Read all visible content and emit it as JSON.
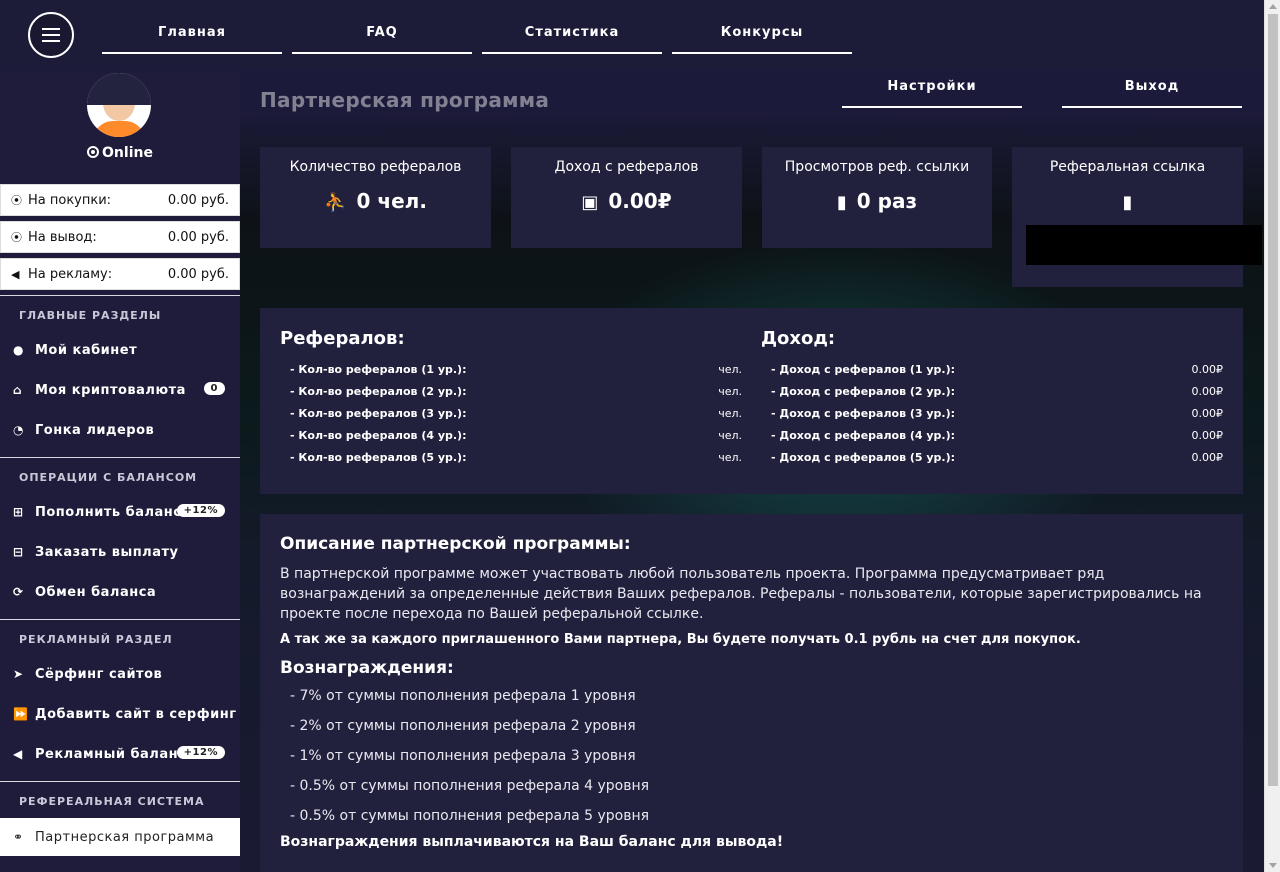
{
  "topnav": [
    "Главная",
    "FAQ",
    "Статистика",
    "Конкурсы"
  ],
  "rightnav": [
    "Настройки",
    "Выход"
  ],
  "user": {
    "status": "Online"
  },
  "balances": [
    {
      "label": "На покупки:",
      "value": "0.00 руб.",
      "icon": "wallet-icon"
    },
    {
      "label": "На вывод:",
      "value": "0.00 руб.",
      "icon": "withdraw-icon"
    },
    {
      "label": "На рекламу:",
      "value": "0.00 руб.",
      "icon": "megaphone-icon"
    }
  ],
  "sections": [
    {
      "title": "ГЛАВНЫЕ РАЗДЕЛЫ",
      "items": [
        {
          "label": "Мой кабинет",
          "icon": "user-icon"
        },
        {
          "label": "Моя криптовалюта",
          "icon": "home-icon",
          "badge": "0"
        },
        {
          "label": "Гонка лидеров",
          "icon": "gauge-icon"
        }
      ]
    },
    {
      "title": "ОПЕРАЦИИ С БАЛАНСОМ",
      "items": [
        {
          "label": "Пополнить баланс",
          "icon": "plus-square-icon",
          "badge": "+12%"
        },
        {
          "label": "Заказать выплату",
          "icon": "minus-square-icon"
        },
        {
          "label": "Обмен баланса",
          "icon": "refresh-icon"
        }
      ]
    },
    {
      "title": "РЕКЛАМНЫЙ РАЗДЕЛ",
      "items": [
        {
          "label": "Сёрфинг сайтов",
          "icon": "pointer-icon"
        },
        {
          "label": "Добавить сайт в серфинг",
          "icon": "fast-forward-icon"
        },
        {
          "label": "Рекламный баланс",
          "icon": "bullhorn-icon",
          "badge": "+12%"
        }
      ]
    },
    {
      "title": "РЕФЕРЕАЛЬНАЯ СИСТЕМА",
      "items": [
        {
          "label": "Партнерская программа",
          "icon": "handshake-icon",
          "active": true
        }
      ]
    }
  ],
  "page": {
    "title": "Партнерская программа"
  },
  "cards": [
    {
      "title": "Количество рефералов",
      "value": "0 чел.",
      "icon": "user-icon"
    },
    {
      "title": "Доход с рефералов",
      "value": "0.00₽",
      "icon": "money-icon"
    },
    {
      "title": "Просмотров реф. ссылки",
      "value": "0 раз",
      "icon": "mouse-icon"
    },
    {
      "title": "Реферальная ссылка",
      "value": "",
      "icon": "mouse-icon"
    }
  ],
  "referrals": {
    "title": "Рефералов:",
    "rows": [
      {
        "label": "- Кол-во рефералов (1 ур.):",
        "value": "чел."
      },
      {
        "label": "- Кол-во рефералов (2 ур.):",
        "value": "чел."
      },
      {
        "label": "- Кол-во рефералов (3 ур.):",
        "value": "чел."
      },
      {
        "label": "- Кол-во рефералов (4 ур.):",
        "value": "чел."
      },
      {
        "label": "- Кол-во рефералов (5 ур.):",
        "value": "чел."
      }
    ]
  },
  "income": {
    "title": "Доход:",
    "rows": [
      {
        "label": "- Доход с рефералов (1 ур.):",
        "value": "0.00₽"
      },
      {
        "label": "- Доход с рефералов (2 ур.):",
        "value": "0.00₽"
      },
      {
        "label": "- Доход с рефералов (3 ур.):",
        "value": "0.00₽"
      },
      {
        "label": "- Доход с рефералов (4 ур.):",
        "value": "0.00₽"
      },
      {
        "label": "- Доход с рефералов (5 ур.):",
        "value": "0.00₽"
      }
    ]
  },
  "description": {
    "title": "Описание партнерской программы:",
    "text": "В партнерской программе может участвовать любой пользователь проекта. Программа предусматривает ряд вознаграждений за определенные действия Ваших рефералов. Рефералы - пользователи, которые зарегистрировались на проекте после перехода по Вашей реферальной ссылке.",
    "bonus": "А так же за каждого приглашенного Вами партнера, Вы будете получать 0.1 рубль на счет для покупок.",
    "rewards_title": "Вознаграждения:",
    "rewards": [
      "- 7% от суммы пополнения реферала 1 уровня",
      "- 2% от суммы пополнения реферала 2 уровня",
      "- 1% от суммы пополнения реферала 3 уровня",
      "- 0.5% от суммы пополнения реферала 4 уровня",
      "- 0.5% от суммы пополнения реферала 5 уровня"
    ],
    "footer": "Вознаграждения выплачиваются на Ваш баланс для вывода!"
  }
}
